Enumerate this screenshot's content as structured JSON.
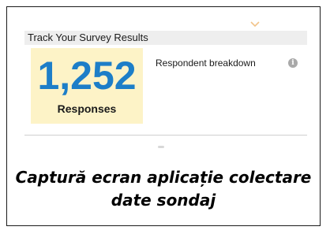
{
  "header": {
    "title": "Track Your Survey Results",
    "icon": "chevron-down-icon"
  },
  "summary": {
    "count": "1,252",
    "count_label": "Responses",
    "breakdown_label": "Respondent breakdown",
    "info_icon_glyph": "i"
  },
  "caption": {
    "line1": "Captură ecran aplicație colectare",
    "line2": "date sondaj"
  },
  "colors": {
    "count_text": "#1d7ec8",
    "count_background": "#fdf3c7",
    "header_background": "#eeeeee",
    "chevron": "#f2c48a"
  }
}
